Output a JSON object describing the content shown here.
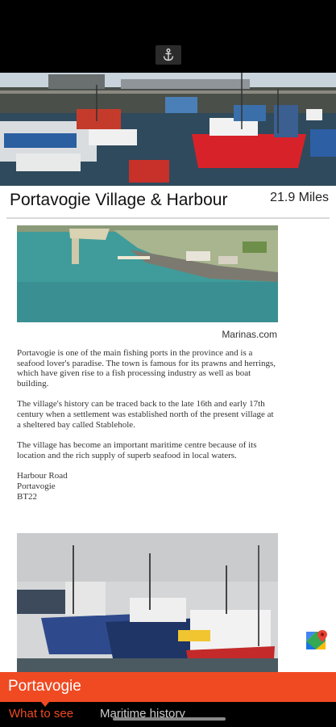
{
  "header": {
    "anchor_icon": "anchor-icon"
  },
  "place": {
    "title": "Portavogie Village & Harbour",
    "distance": "21.9 Miles",
    "image_credit": "Marinas.com",
    "paragraphs": [
      "Portavogie is one of the main fishing ports in the province and is a seafood lover's paradise. The town is famous for its prawns and herrings, which have given rise to a fish processing industry as well as boat building.",
      "The village's history can be traced back to the late 16th and early 17th century when a settlement was established north of the present village at a sheltered bay called Stablehole.",
      "The village has become an important maritime centre because of its location and the rich supply of superb seafood in local waters."
    ],
    "address": [
      "Harbour Road",
      "Portavogie",
      "BT22"
    ]
  },
  "maps_icon": "google-maps-icon",
  "bottom": {
    "title": "Portavogie",
    "tabs": [
      "What to see",
      "Maritime history"
    ]
  },
  "colors": {
    "accent": "#f04a22",
    "background": "#000000"
  }
}
